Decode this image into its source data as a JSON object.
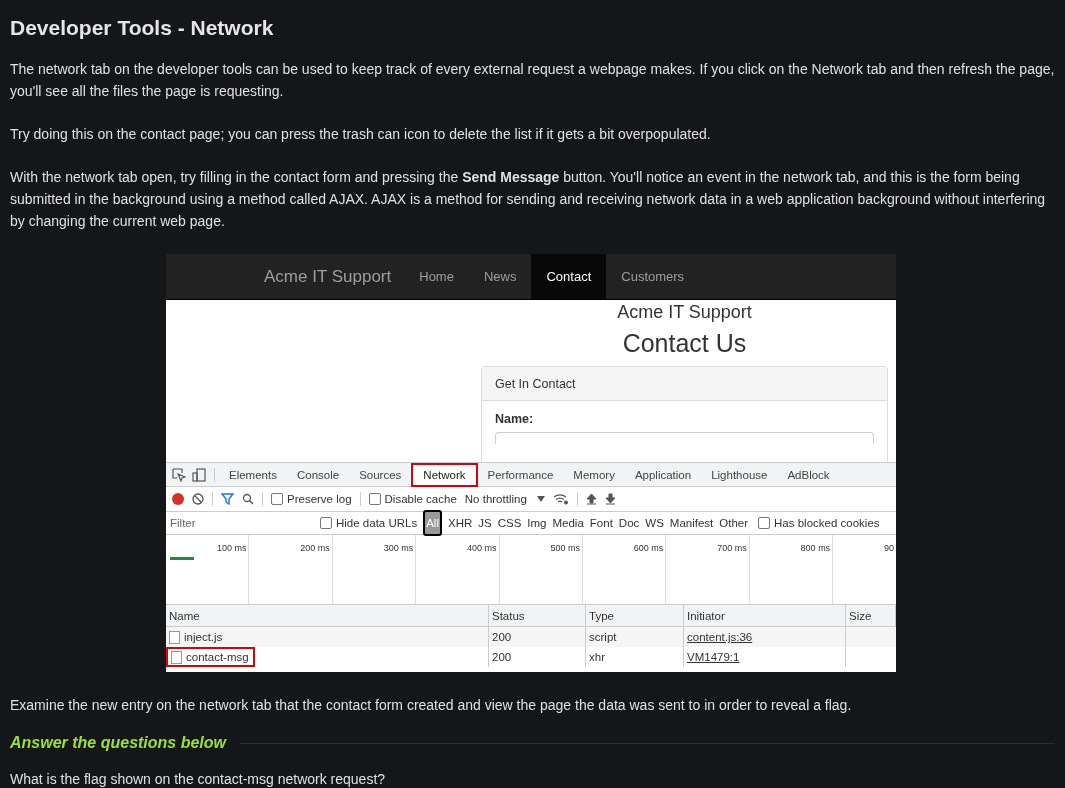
{
  "heading": "Developer Tools - Network",
  "paragraphs": [
    "The network tab on the developer tools can be used to keep track of every external request a webpage makes. If you click on the Network tab and then refresh the page, you'll see all the files the page is requesting.",
    "Try doing this on the contact page; you can press the trash can icon to delete the list if it gets a bit overpopulated.",
    "With the network tab open, try filling in the contact form and pressing the **Send Message** button. You'll notice an event in the network tab, and this is the form being submitted in the background using a method called AJAX. AJAX is a method for sending and receiving network data in a web application background without interfering by changing the current web page."
  ],
  "screenshot": {
    "site": {
      "brand": "Acme IT Support",
      "nav": [
        {
          "label": "Home",
          "selected": false
        },
        {
          "label": "News",
          "selected": false
        },
        {
          "label": "Contact",
          "selected": true
        },
        {
          "label": "Customers",
          "selected": false
        }
      ],
      "page_heading": "Acme IT Support",
      "title": "Contact Us",
      "card_header": "Get In Contact",
      "field_label": "Name:"
    },
    "devtools": {
      "tabs": [
        {
          "label": "Elements",
          "selected": false,
          "highlighted": false
        },
        {
          "label": "Console",
          "selected": false,
          "highlighted": false
        },
        {
          "label": "Sources",
          "selected": false,
          "highlighted": false
        },
        {
          "label": "Network",
          "selected": true,
          "highlighted": true
        },
        {
          "label": "Performance",
          "selected": false,
          "highlighted": false
        },
        {
          "label": "Memory",
          "selected": false,
          "highlighted": false
        },
        {
          "label": "Application",
          "selected": false,
          "highlighted": false
        },
        {
          "label": "Lighthouse",
          "selected": false,
          "highlighted": false
        },
        {
          "label": "AdBlock",
          "selected": false,
          "highlighted": false
        }
      ],
      "preserve_log": {
        "label": "Preserve log",
        "checked": false
      },
      "disable_cache": {
        "label": "Disable cache",
        "checked": false
      },
      "throttling": "No throttling",
      "filter_placeholder": "Filter",
      "hide_data_urls": {
        "label": "Hide data URLs",
        "checked": false
      },
      "types": [
        {
          "label": "All",
          "selected": true
        },
        {
          "label": "XHR",
          "selected": false
        },
        {
          "label": "JS",
          "selected": false
        },
        {
          "label": "CSS",
          "selected": false
        },
        {
          "label": "Img",
          "selected": false
        },
        {
          "label": "Media",
          "selected": false
        },
        {
          "label": "Font",
          "selected": false
        },
        {
          "label": "Doc",
          "selected": false
        },
        {
          "label": "WS",
          "selected": false
        },
        {
          "label": "Manifest",
          "selected": false
        },
        {
          "label": "Other",
          "selected": false
        }
      ],
      "has_blocked_cookies": {
        "label": "Has blocked cookies",
        "checked": false
      },
      "timeline_ticks": [
        "100 ms",
        "200 ms",
        "300 ms",
        "400 ms",
        "500 ms",
        "600 ms",
        "700 ms",
        "800 ms",
        "90"
      ],
      "columns": [
        "Name",
        "Status",
        "Type",
        "Initiator",
        "Size"
      ],
      "rows": [
        {
          "name": "inject.js",
          "status": "200",
          "type": "script",
          "initiator": "content.js:36",
          "highlighted": false
        },
        {
          "name": "contact-msg",
          "status": "200",
          "type": "xhr",
          "initiator": "VM1479:1",
          "highlighted": true
        }
      ]
    }
  },
  "after_text": "Examine the new entry on the network tab that the contact form created and view the page the data was sent to in order to reveal a flag.",
  "questions_heading": "Answer the questions below",
  "question": "What is the flag shown on the contact-msg network request?"
}
